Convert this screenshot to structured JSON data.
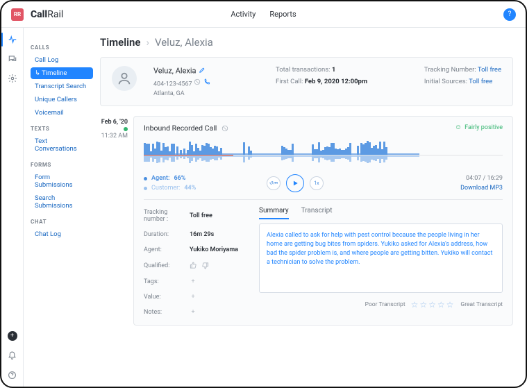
{
  "top": {
    "avatar": "RR",
    "logo_bold": "Call",
    "logo_rest": "Rail",
    "nav": [
      "Activity",
      "Reports"
    ]
  },
  "sidebar": {
    "groups": [
      {
        "title": "CALLS",
        "items": [
          "Call Log",
          "Timeline",
          "Transcript Search",
          "Unique Callers",
          "Voicemail"
        ],
        "active": 1
      },
      {
        "title": "TEXTS",
        "items": [
          "Text Conversations"
        ]
      },
      {
        "title": "FORMS",
        "items": [
          "Form Submissions",
          "Search Submissions"
        ]
      },
      {
        "title": "CHAT",
        "items": [
          "Chat Log"
        ]
      }
    ]
  },
  "crumb": {
    "root": "Timeline",
    "name": "Veluz, Alexia"
  },
  "contact": {
    "name": "Veluz, Alexia",
    "phone": "404-123-4567",
    "location": "Atlanta, GA",
    "total_label": "Total transactions:",
    "total_value": "1",
    "first_label": "First Call:",
    "first_value": "Feb 9, 2020 12:00pm",
    "tracking_label": "Tracking Number:",
    "tracking_value": "Toll free",
    "sources_label": "Initial Sources:",
    "sources_value": "Toll free"
  },
  "call": {
    "date": "Feb 6, '20",
    "time": "11:32 AM",
    "title": "Inbound Recorded Call",
    "sentiment": "Fairly positive",
    "agent_label": "Agent:",
    "agent_pct": "66%",
    "customer_label": "Customer:",
    "customer_pct": "44%",
    "back_btn": "↺⏮",
    "speed_btn": "1x",
    "elapsed": "04:07",
    "total": "16:29",
    "download": "Download MP3",
    "kv": {
      "tracking_k": "Tracking number :",
      "tracking_v": "Toll free",
      "duration_k": "Duration:",
      "duration_v": "16m 29s",
      "agent_k": "Agent:",
      "agent_v": "Yukiko Moriyama",
      "qualified_k": "Qualified:",
      "tags_k": "Tags:",
      "value_k": "Value:",
      "notes_k": "Notes:"
    },
    "tab_summary": "Summary",
    "tab_transcript": "Transcript",
    "summary": "Alexia called to ask for help with pest control because the people living in her home are getting bug bites from spiders. Yukiko asked for Alexia's address, how bad the spider problem is, and where people are getting bitten. Yukiko will contact a technician to solve the problem.",
    "rating_poor": "Poor Transcript",
    "rating_great": "Great Transcript",
    "progress_pct": 25
  }
}
